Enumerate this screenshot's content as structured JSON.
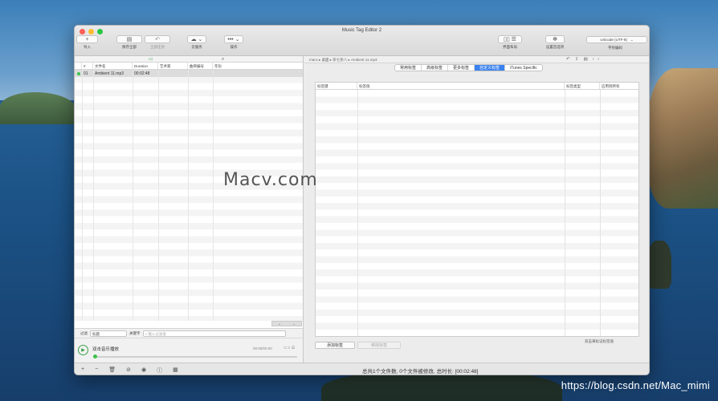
{
  "window": {
    "title": "Music Tag Editor 2"
  },
  "toolbar": {
    "import": {
      "icon": "plus-icon",
      "label": "导入"
    },
    "save_all": {
      "icon": "save-icon",
      "label": "保存全部"
    },
    "revert_all": {
      "icon": "undo-icon",
      "label": "全部还原"
    },
    "cloud": {
      "icon": "cloud-icon",
      "label": "云服务"
    },
    "actions": {
      "icon": "ellipsis-icon",
      "label": "操作"
    },
    "layout": {
      "icon": "layout-icon",
      "label": "界面布局"
    },
    "prefs": {
      "icon": "gear-icon",
      "label": "设置首选项"
    },
    "encoding": {
      "value": "Unicode (UTF-8)",
      "label": "字符编码"
    }
  },
  "file_list": {
    "columns": [
      "#",
      "文件名",
      "Duration",
      "艺术家",
      "曲目编号",
      "年份"
    ],
    "rows": [
      {
        "num": "01",
        "filename": "Ambient 11.mp3",
        "duration": "00:02:48",
        "artist": "",
        "track": "",
        "year": ""
      }
    ]
  },
  "filter": {
    "label": "过滤",
    "select": "标题",
    "keyword_label": "关键字",
    "placeholder": "输入过滤值"
  },
  "player": {
    "title": "双击音乐播放",
    "time": "00:00/00:00",
    "progress": 0
  },
  "breadcrumb": "macx ▸ 桌面 ▸ 杂七杂八 ▸ Ambient 11.mp3",
  "tabs": [
    "常用标签",
    "高级标签",
    "更多标签",
    "自定义标签",
    "iTunes Specific"
  ],
  "active_tab": 3,
  "tag_table": {
    "columns": [
      "标签键",
      "标签值",
      "标签类型",
      "应用到所有"
    ]
  },
  "buttons": {
    "add_tag": "添加标签",
    "remove_tag": "移除标签"
  },
  "hint": "双击来标记标签值",
  "status": "总共1个文件数, 0个文件被修改, 总时长: [00:02:48]",
  "watermarks": {
    "macv": "Macv.com",
    "csdn": "https://blog.csdn.net/Mac_mimi"
  }
}
